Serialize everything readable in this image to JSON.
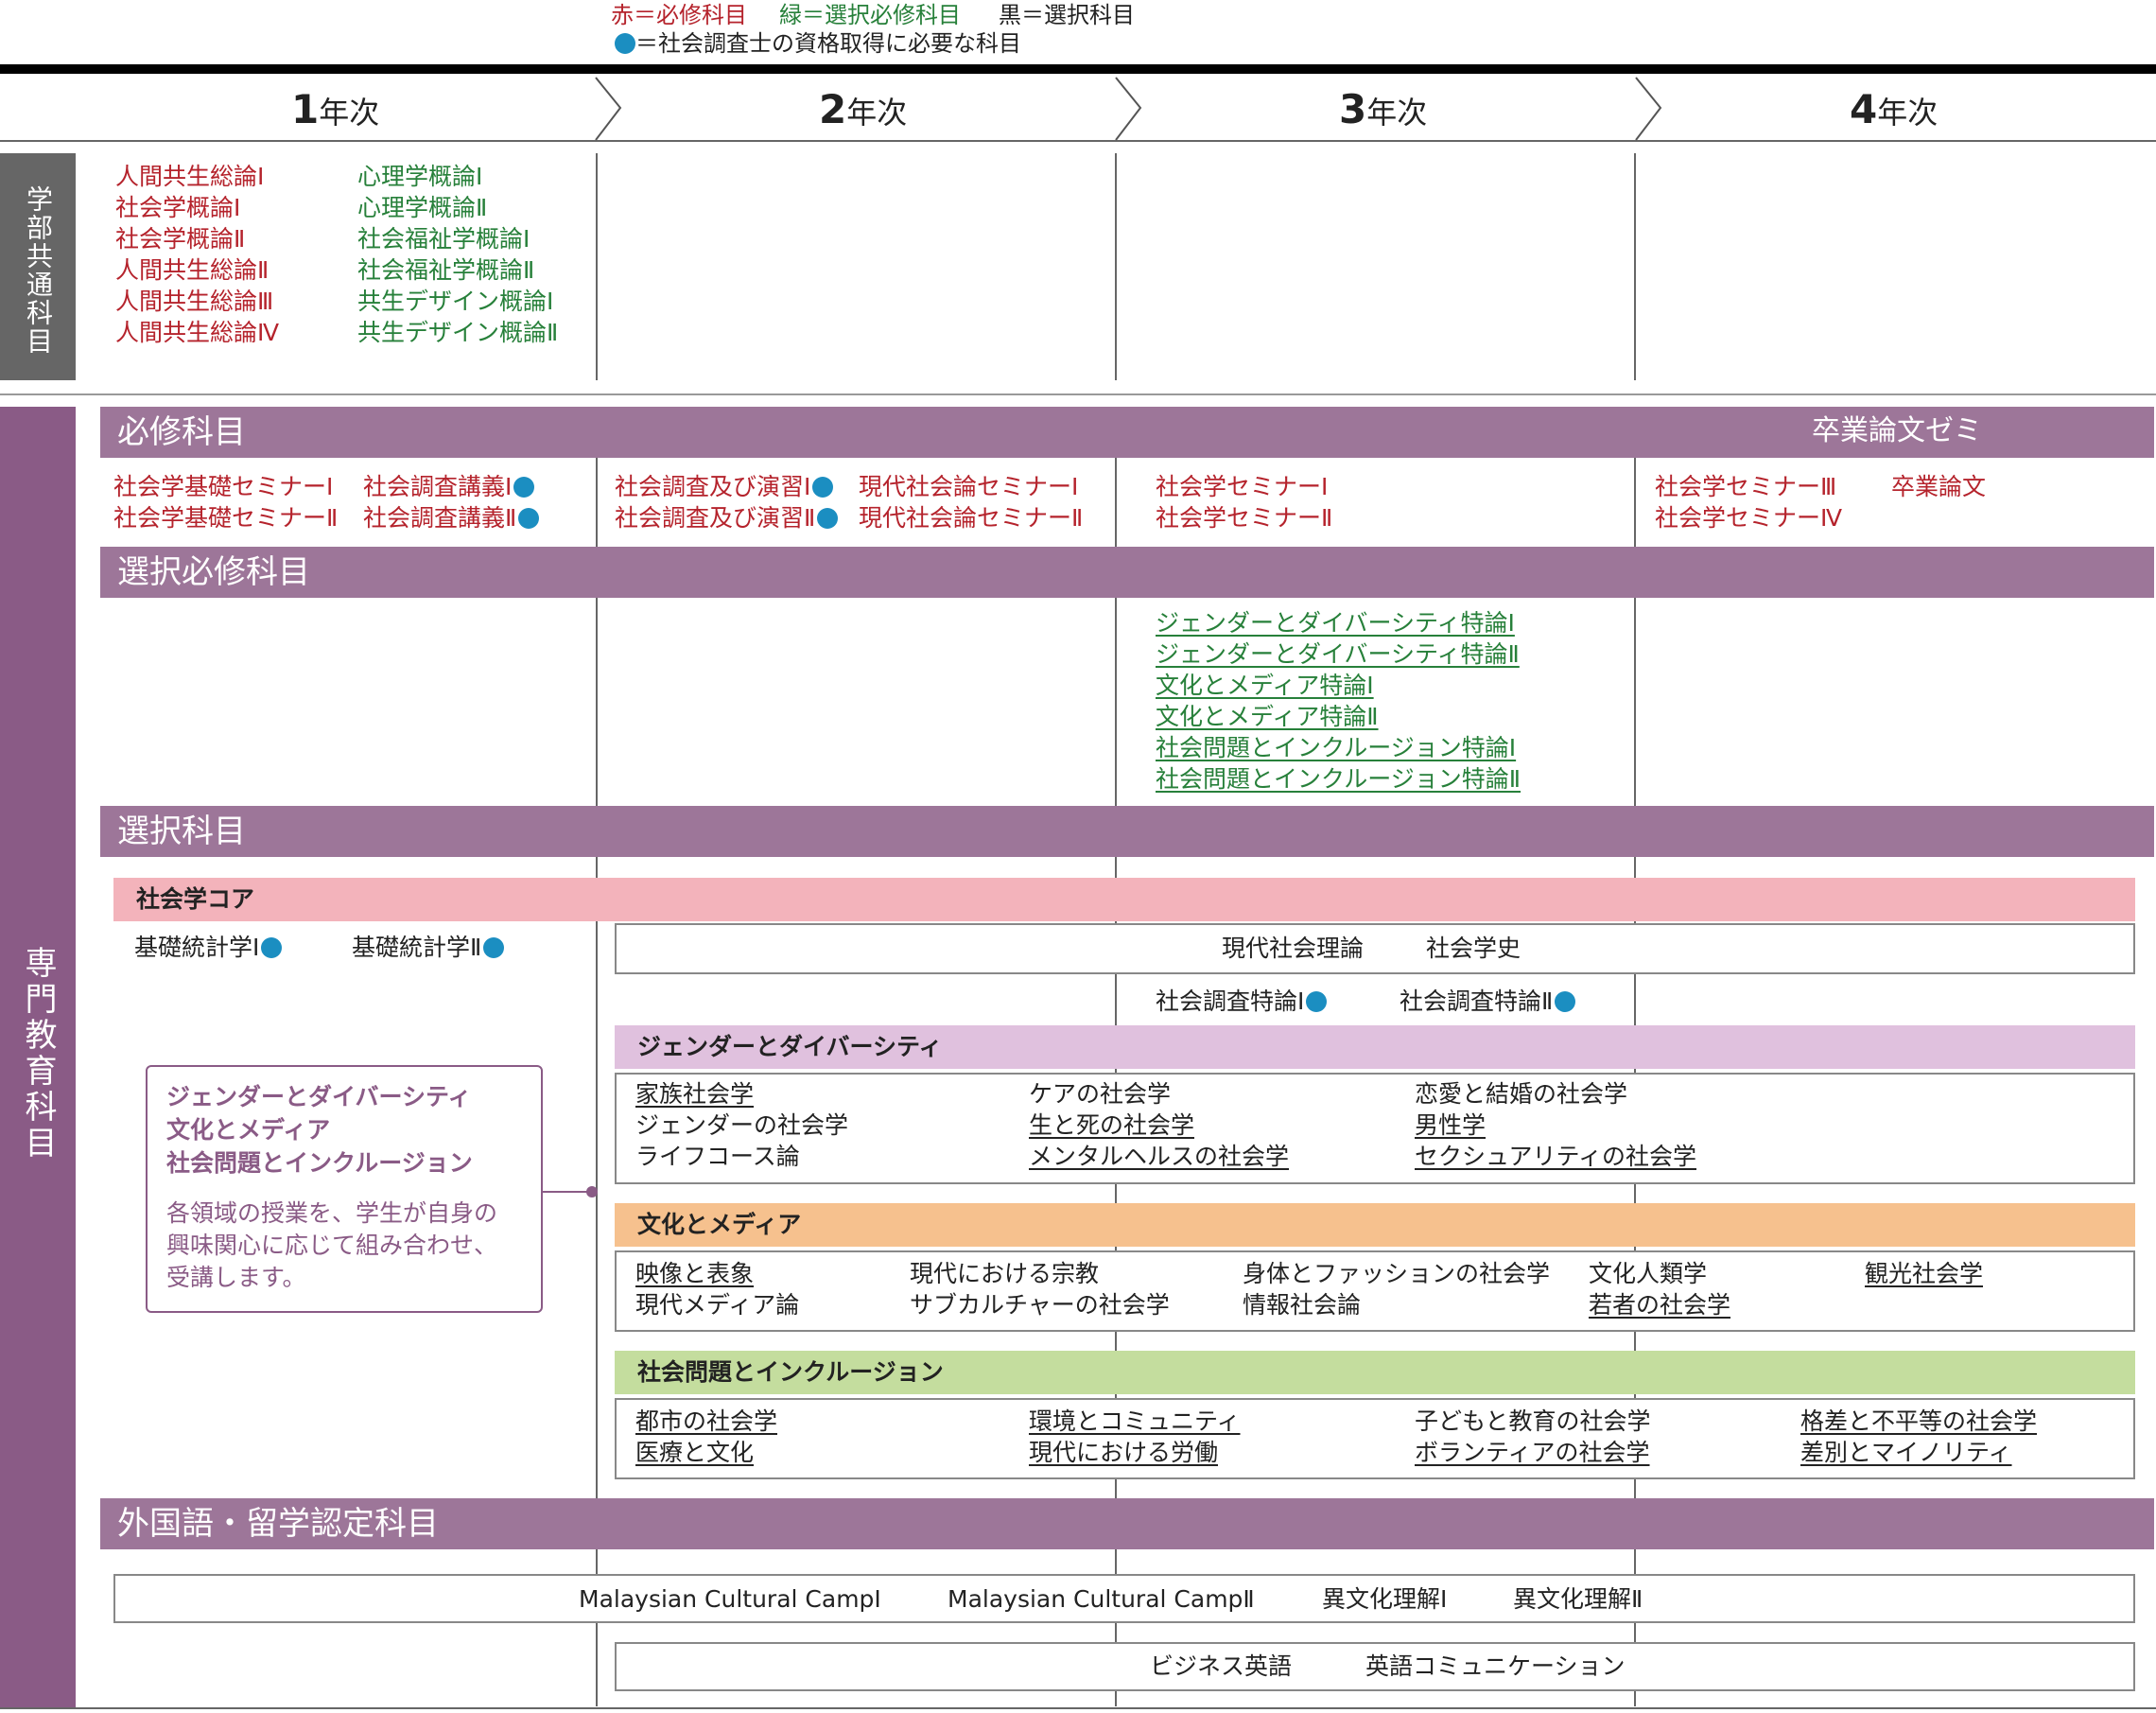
{
  "legend": {
    "line1_red": "赤＝必修科目",
    "line1_green": "緑＝選択必修科目",
    "line1_black": "黒＝選択科目",
    "line2": "＝社会調査士の資格取得に必要な科目"
  },
  "years": [
    {
      "num": "1",
      "suffix": "年次"
    },
    {
      "num": "2",
      "suffix": "年次"
    },
    {
      "num": "3",
      "suffix": "年次"
    },
    {
      "num": "4",
      "suffix": "年次"
    }
  ],
  "side_labels": {
    "faculty_common": "学部共通科目",
    "specialized": "専門教育科目"
  },
  "faculty_common": {
    "red": [
      "人間共生総論Ⅰ",
      "社会学概論Ⅰ",
      "社会学概論Ⅱ",
      "人間共生総論Ⅱ",
      "人間共生総論Ⅲ",
      "人間共生総論Ⅳ"
    ],
    "green": [
      "心理学概論Ⅰ",
      "心理学概論Ⅱ",
      "社会福祉学概論Ⅰ",
      "社会福祉学概論Ⅱ",
      "共生デザイン概論Ⅰ",
      "共生デザイン概論Ⅱ"
    ]
  },
  "required": {
    "title": "必修科目",
    "seminar_label": "卒業論文ゼミ",
    "y1_col1": [
      "社会学基礎セミナーⅠ",
      "社会学基礎セミナーⅡ"
    ],
    "y1_col2": [
      "社会調査講義Ⅰ",
      "社会調査講義Ⅱ"
    ],
    "y2_col1": [
      "社会調査及び演習Ⅰ",
      "社会調査及び演習Ⅱ"
    ],
    "y2_col2": [
      "現代社会論セミナーⅠ",
      "現代社会論セミナーⅡ"
    ],
    "y3": [
      "社会学セミナーⅠ",
      "社会学セミナーⅡ"
    ],
    "y4_col1": [
      "社会学セミナーⅢ",
      "社会学セミナーⅣ"
    ],
    "y4_col2": "卒業論文"
  },
  "elective_required": {
    "title": "選択必修科目",
    "items": [
      "ジェンダーとダイバーシティ特論Ⅰ",
      "ジェンダーとダイバーシティ特論Ⅱ",
      "文化とメディア特論Ⅰ",
      "文化とメディア特論Ⅱ",
      "社会問題とインクルージョン特論Ⅰ",
      "社会問題とインクルージョン特論Ⅱ"
    ]
  },
  "elective": {
    "title": "選択科目",
    "core_title": "社会学コア",
    "stats1": "基礎統計学Ⅰ",
    "stats2": "基礎統計学Ⅱ",
    "core_box": [
      "現代社会理論",
      "社会学史"
    ],
    "survey1": "社会調査特論Ⅰ",
    "survey2": "社会調査特論Ⅱ",
    "note_title": [
      "ジェンダーとダイバーシティ",
      "文化とメディア",
      "社会問題とインクルージョン"
    ],
    "note_body": [
      "各領域の授業を、学生が自身の",
      "興味関心に応じて組み合わせ、",
      "受講します。"
    ],
    "gender": {
      "title": "ジェンダーとダイバーシティ",
      "col1": [
        "家族社会学",
        "ジェンダーの社会学",
        "ライフコース論"
      ],
      "col2": [
        "ケアの社会学",
        "生と死の社会学",
        "メンタルヘルスの社会学"
      ],
      "col3": [
        "恋愛と結婚の社会学",
        "男性学",
        "セクシュアリティの社会学"
      ]
    },
    "culture": {
      "title": "文化とメディア",
      "col1": [
        "映像と表象",
        "現代メディア論"
      ],
      "col2": [
        "現代における宗教",
        "サブカルチャーの社会学"
      ],
      "col3": [
        "身体とファッションの社会学",
        "情報社会論"
      ],
      "col4": [
        "文化人類学",
        "若者の社会学"
      ],
      "col5": [
        "観光社会学"
      ]
    },
    "social": {
      "title": "社会問題とインクルージョン",
      "col1": [
        "都市の社会学",
        "医療と文化"
      ],
      "col2": [
        "環境とコミュニティ",
        "現代における労働"
      ],
      "col3": [
        "子どもと教育の社会学",
        "ボランティアの社会学"
      ],
      "col4": [
        "格差と不平等の社会学",
        "差別とマイノリティ"
      ]
    }
  },
  "foreign": {
    "title": "外国語・留学認定科目",
    "row1": [
      "Malaysian Cultural CampⅠ",
      "Malaysian Cultural CampⅡ",
      "異文化理解Ⅰ",
      "異文化理解Ⅱ"
    ],
    "row2": [
      "ビジネス英語",
      "英語コミュニケーション"
    ]
  },
  "colors": {
    "band": "#9d7699",
    "side_gray": "#666666",
    "side_purple": "#8a5b86",
    "core_pink": "#f3b3bb",
    "gender_lilac": "#e0c1de",
    "culture_orange": "#f6c18e",
    "social_green": "#c4dd9e",
    "dot_blue": "#1b8ec1"
  }
}
